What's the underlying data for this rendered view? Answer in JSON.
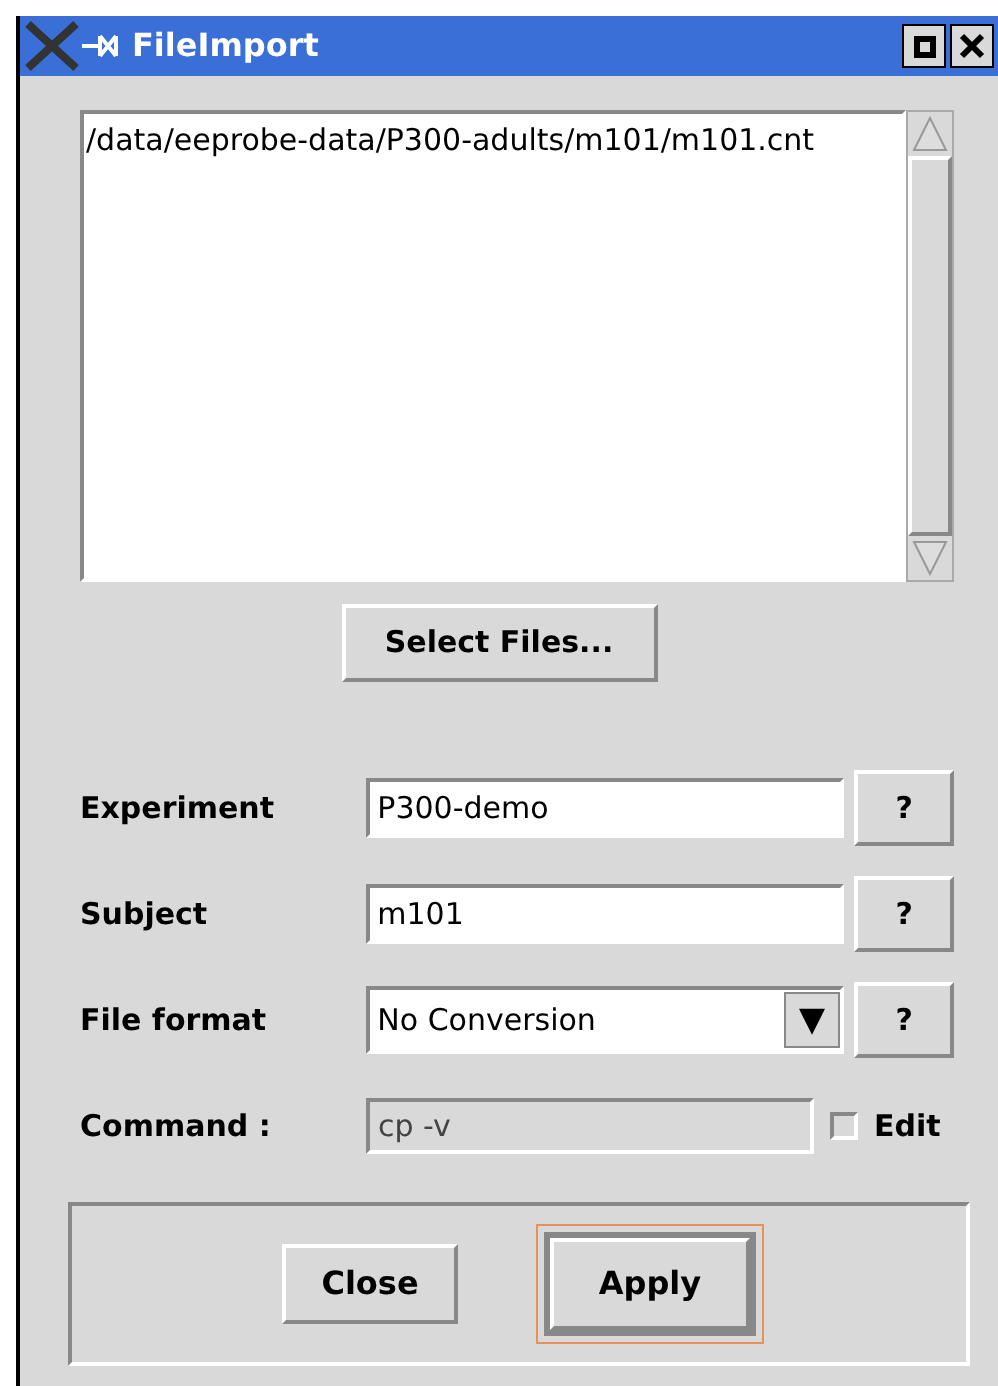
{
  "window": {
    "title": "FileImport"
  },
  "file_list": {
    "items": [
      "/data/eeprobe-data/P300-adults/m101/m101.cnt"
    ]
  },
  "select_files_button": "Select Files...",
  "fields": [
    {
      "kind": "text",
      "label": "Experiment",
      "value": "P300-demo",
      "help": "?"
    },
    {
      "kind": "text",
      "label": "Subject",
      "value": "m101",
      "help": "?"
    },
    {
      "kind": "dropdown",
      "label": "File format",
      "value": "No Conversion",
      "help": "?"
    },
    {
      "kind": "command",
      "label": "Command :",
      "value": "cp -v",
      "disabled": true,
      "edit": {
        "label": "Edit",
        "checked": false
      }
    }
  ],
  "buttons": [
    {
      "label": "Close",
      "focused": false
    },
    {
      "label": "Apply",
      "focused": true
    }
  ]
}
